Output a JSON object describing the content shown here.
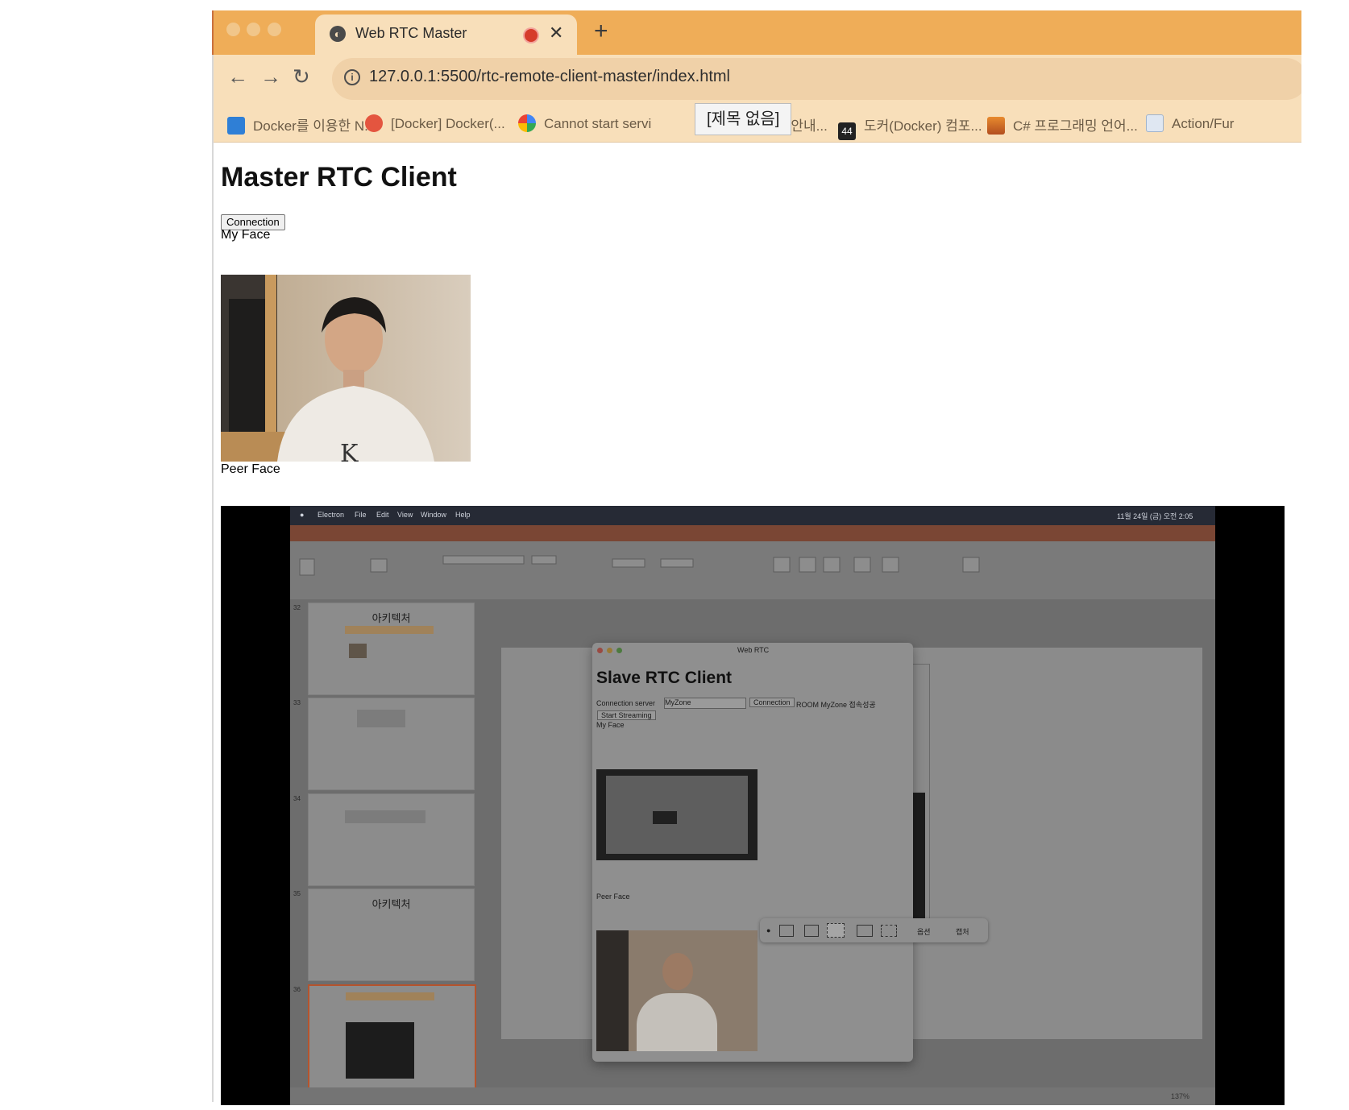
{
  "browser": {
    "tab_title": "Web RTC Master",
    "url": "127.0.0.1:5500/rtc-remote-client-master/index.html",
    "tooltip": "[제목 없음]",
    "bookmarks": [
      {
        "label": "Docker를 이용한 N...",
        "icon": "dale-icon"
      },
      {
        "label": "[Docker] Docker(...",
        "icon": "velog-icon"
      },
      {
        "label": "Cannot start servi",
        "icon": "google-icon"
      },
      {
        "label": "한 도커 안내...",
        "icon": ""
      },
      {
        "label": "도커(Docker) 컴포...",
        "icon": "44-icon"
      },
      {
        "label": "C# 프로그래밍 언어...",
        "icon": "photo-icon"
      },
      {
        "label": "Action/Fur",
        "icon": "doc-icon"
      }
    ],
    "bookmark_44": "44"
  },
  "page": {
    "title": "Master RTC Client",
    "connection_button": "Connection",
    "my_face_label": "My Face",
    "peer_face_label": "Peer Face"
  },
  "shared_screen": {
    "menubar": [
      "Electron",
      "File",
      "Edit",
      "View",
      "Window",
      "Help"
    ],
    "clock": "11월 24일 (금) 오전 2:05",
    "thumbnails": [
      {
        "num": "32",
        "title": "아키텍처"
      },
      {
        "num": "33",
        "title": ""
      },
      {
        "num": "34",
        "title": ""
      },
      {
        "num": "35",
        "title": "아키텍처"
      },
      {
        "num": "36",
        "title": ""
      }
    ],
    "slave_window": {
      "window_title": "Web RTC",
      "title": "Slave RTC Client",
      "server_label": "Connection server",
      "server_value": "MyZone",
      "connection_button": "Connection",
      "room_text": "ROOM MyZone 접속성공",
      "start_streaming": "Start Streaming",
      "my_face": "My Face",
      "peer_face": "Peer Face"
    },
    "capture_options": "옵션",
    "capture_action": "캡처",
    "zoom": "137%"
  }
}
